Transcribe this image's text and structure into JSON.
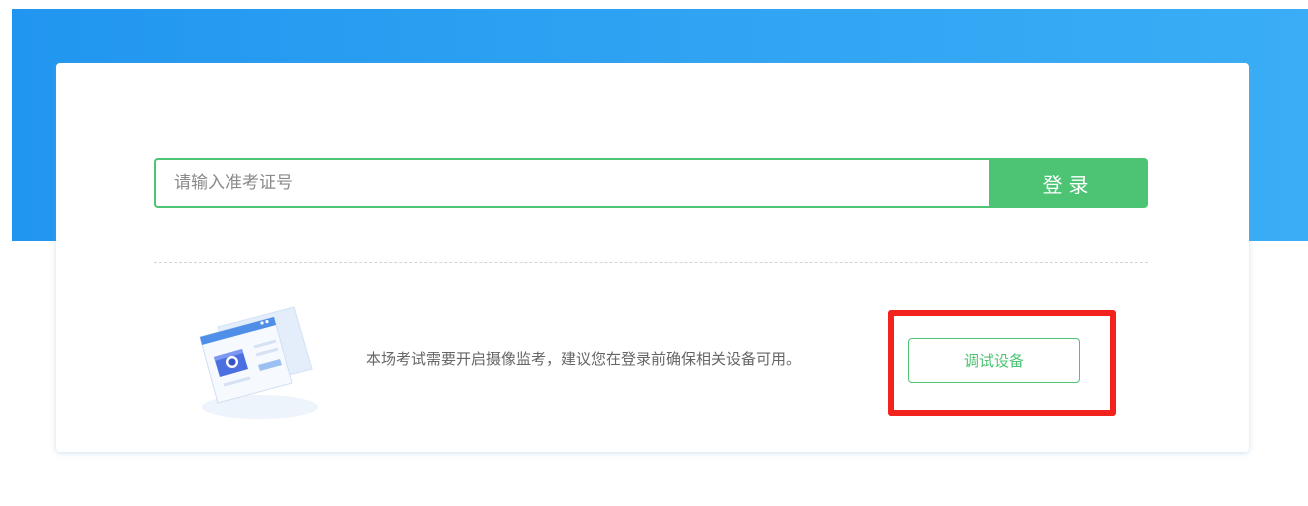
{
  "login": {
    "input_placeholder": "请输入准考证号",
    "input_value": "",
    "button_label": "登录"
  },
  "device_check": {
    "notice_text": "本场考试需要开启摄像监考，建议您在登录前确保相关设备可用。",
    "button_label": "调试设备",
    "illustration_icon": "webcam-document-icon"
  },
  "colors": {
    "banner": "#2fa3f2",
    "accent_green": "#4cc473",
    "highlight_red": "#f2231c",
    "notice_text": "#666666"
  }
}
